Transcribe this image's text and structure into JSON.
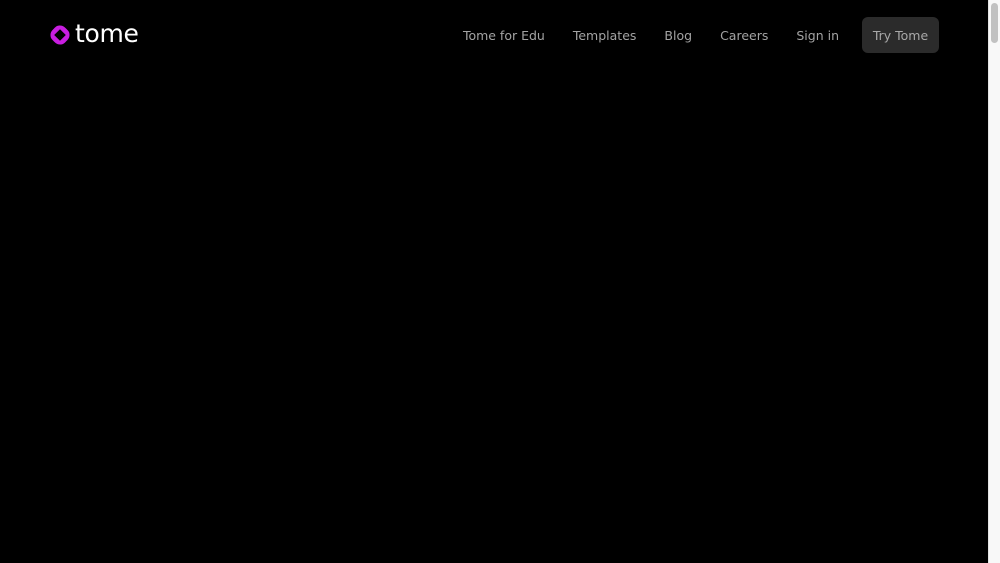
{
  "brand": {
    "name": "tome",
    "icon": "tome-logo-icon",
    "accent_color": "#c81ee0"
  },
  "nav": {
    "links": [
      {
        "label": "Tome for Edu"
      },
      {
        "label": "Templates"
      },
      {
        "label": "Blog"
      },
      {
        "label": "Careers"
      },
      {
        "label": "Sign in"
      }
    ],
    "cta_label": "Try Tome"
  },
  "colors": {
    "background": "#000000",
    "nav_text": "#a3a3a3",
    "cta_background": "#2b2b2b"
  }
}
